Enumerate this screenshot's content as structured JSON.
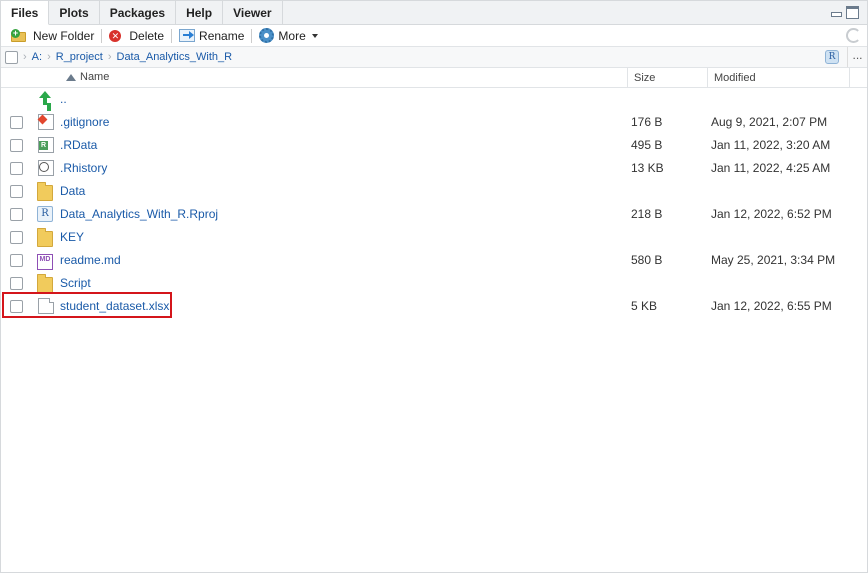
{
  "tabs": [
    "Files",
    "Plots",
    "Packages",
    "Help",
    "Viewer"
  ],
  "toolbar": {
    "new_folder": "New Folder",
    "delete": "Delete",
    "rename": "Rename",
    "more": "More"
  },
  "breadcrumb": [
    "A:",
    "R_project",
    "Data_Analytics_With_R"
  ],
  "breadcrumb_more": "...",
  "columns": {
    "name": "Name",
    "size": "Size",
    "modified": "Modified"
  },
  "rows": [
    {
      "icon": "parent-dir-icon",
      "name": "..",
      "size": "",
      "modified": ""
    },
    {
      "icon": "git-file-icon",
      "name": ".gitignore",
      "size": "176 B",
      "modified": "Aug 9, 2021, 2:07 PM"
    },
    {
      "icon": "rdata-file-icon",
      "name": ".RData",
      "size": "495 B",
      "modified": "Jan 11, 2022, 3:20 AM"
    },
    {
      "icon": "history-file-icon",
      "name": ".Rhistory",
      "size": "13 KB",
      "modified": "Jan 11, 2022, 4:25 AM"
    },
    {
      "icon": "folder-icon",
      "name": "Data",
      "size": "",
      "modified": ""
    },
    {
      "icon": "rproj-file-icon",
      "name": "Data_Analytics_With_R.Rproj",
      "size": "218 B",
      "modified": "Jan 12, 2022, 6:52 PM"
    },
    {
      "icon": "folder-icon",
      "name": "KEY",
      "size": "",
      "modified": ""
    },
    {
      "icon": "markdown-file-icon",
      "name": "readme.md",
      "size": "580 B",
      "modified": "May 25, 2021, 3:34 PM"
    },
    {
      "icon": "folder-icon",
      "name": "Script",
      "size": "",
      "modified": ""
    },
    {
      "icon": "file-icon",
      "name": "student_dataset.xlsx",
      "size": "5 KB",
      "modified": "Jan 12, 2022, 6:55 PM"
    }
  ],
  "colors": {
    "link": "#1a5aa8",
    "highlight": "#d4151b"
  }
}
